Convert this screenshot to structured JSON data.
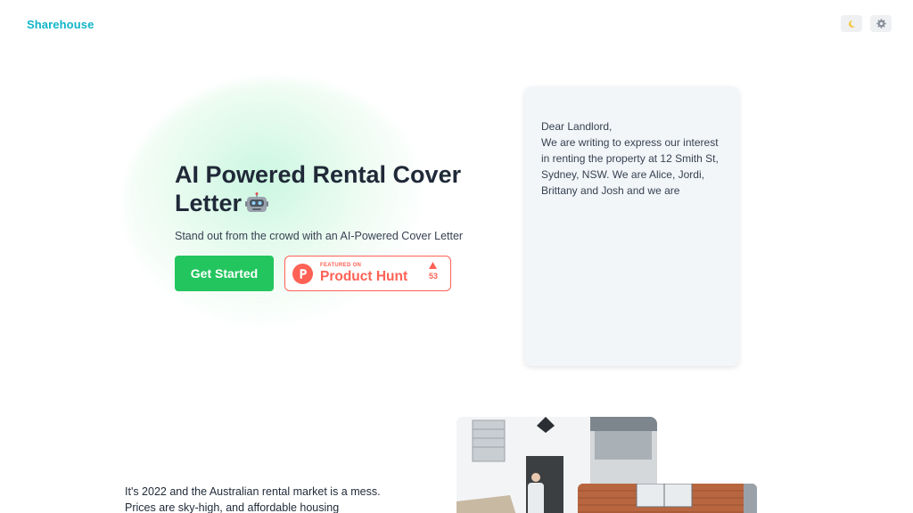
{
  "header": {
    "logo": "Sharehouse",
    "theme_toggle_icon": "moon-icon",
    "settings_icon": "gear-icon"
  },
  "hero": {
    "title": "AI Powered Rental Cover Letter",
    "title_icon": "robot-icon",
    "subtitle": "Stand out from the crowd with an AI-Powered Cover Letter",
    "cta_label": "Get Started",
    "product_hunt": {
      "featured_on": "FEATURED ON",
      "name": "Product Hunt",
      "upvotes": "53"
    }
  },
  "letter_preview": {
    "lines": [
      "Dear Landlord,",
      "We are writing to express our interest in renting the property at 12 Smith St, Sydney, NSW. We are Alice, Jordi, Brittany and Josh and we are"
    ]
  },
  "about": {
    "text": "It's 2022 and the Australian rental market is a mess. Prices are sky-high, and affordable housing"
  },
  "colors": {
    "brand": "#10b5c9",
    "cta": "#22c55e",
    "product_hunt": "#ff6154"
  }
}
